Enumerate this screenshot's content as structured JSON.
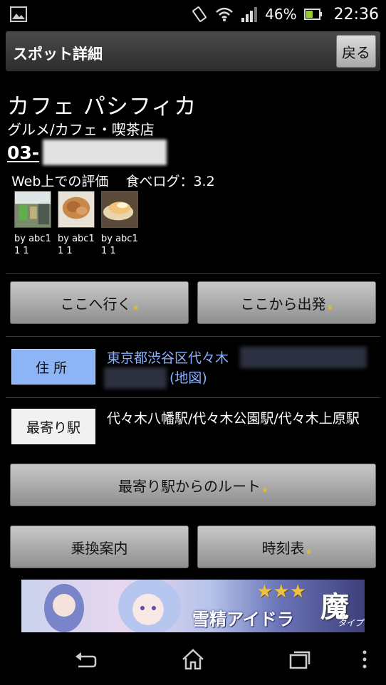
{
  "status_bar": {
    "battery": "46%",
    "time": "22:36"
  },
  "header": {
    "title": "スポット詳細",
    "back_label": "戻る"
  },
  "spot": {
    "name": "カフェ パシフィカ",
    "category": "グルメ/カフェ・喫茶店",
    "phone_prefix": "03-",
    "rating_label": "Web上での評価",
    "rating_value": "食べログ：3.2",
    "photos": [
      {
        "by": "by abc11 1"
      },
      {
        "by": "by abc11 1"
      },
      {
        "by": "by abc11 1"
      }
    ]
  },
  "actions": {
    "go_here": "ここへ行く",
    "depart_here": "ここから出発"
  },
  "address": {
    "label": "住所",
    "text": "東京都渋谷区代々木",
    "map_link": "(地図)"
  },
  "station": {
    "label": "最寄り駅",
    "text": "代々木八幡駅/代々木公園駅/代々木上原駅"
  },
  "route_button": "最寄り駅からのルート",
  "transit_button": "乗換案内",
  "timetable_button": "時刻表",
  "banner": {
    "title": "雪精アイドラ",
    "kanji": "魔",
    "type": "タイプ",
    "stars": "★★★"
  },
  "colors": {
    "accent_blue": "#8db4f5",
    "link_blue": "#8ab0ff",
    "crown": "#f1c40f"
  }
}
